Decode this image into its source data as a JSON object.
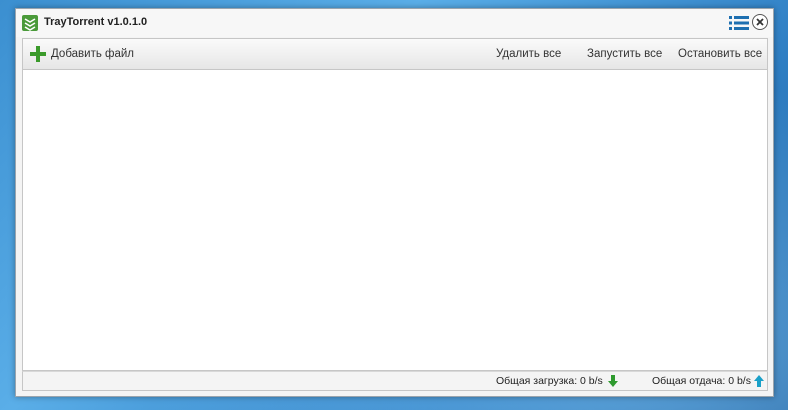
{
  "window": {
    "title": "TrayTorrent v1.0.1.0"
  },
  "toolbar": {
    "add_label": "Добавить файл",
    "delete_all_label": "Удалить все",
    "start_all_label": "Запустить все",
    "stop_all_label": "Остановить все"
  },
  "status": {
    "download_text": "Общая загрузка: 0 b/s",
    "upload_text": "Общая отдача: 0 b/s"
  },
  "icons": {
    "app": "traytorrent-logo-icon",
    "menu": "list-menu-icon",
    "close": "close-icon",
    "add": "plus-icon",
    "download": "arrow-down-icon",
    "upload": "arrow-up-icon"
  },
  "colors": {
    "accent_blue": "#1e6fb0",
    "add_green": "#3a9a2a",
    "download_green": "#2e9a2e",
    "upload_teal": "#1aa0c8"
  },
  "torrents": []
}
